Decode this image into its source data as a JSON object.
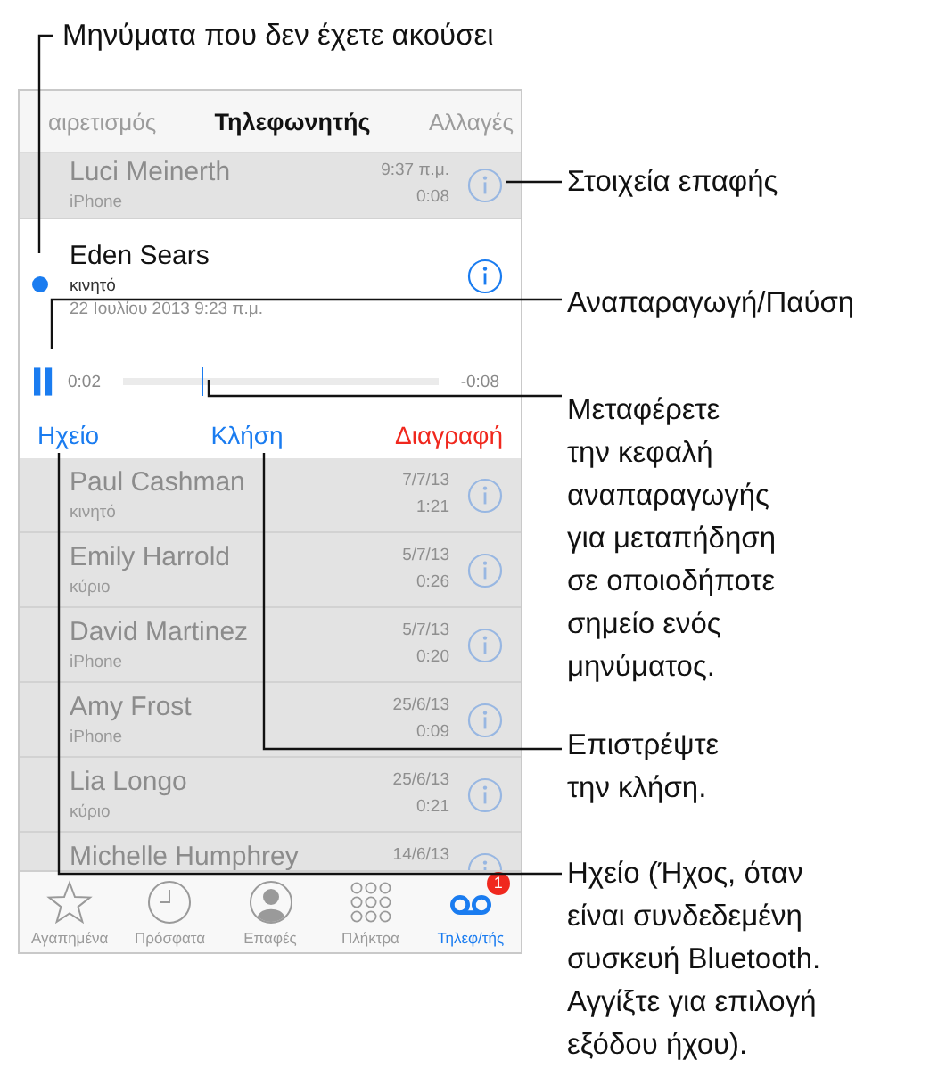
{
  "callouts": [
    {
      "text": "Μηνύματα που δεν έχετε ακούσει"
    },
    {
      "text": "Στοιχεία επαφής"
    },
    {
      "text": "Αναπαραγωγή/Παύση"
    },
    {
      "text": "Μεταφέρετε\nτην κεφαλή\nαναπαραγωγής\nγια μεταπήδηση\nσε οποιοδήποτε\nσημείο ενός\nμηνύματος."
    },
    {
      "text": "Επιστρέψτε\nτην κλήση."
    },
    {
      "text": "Ηχείο (Ήχος, όταν\nείναι συνδεδεμένη\nσυσκευή Bluetooth.\nΑγγίξτε για επιλογή\nεξόδου ήχου)."
    }
  ],
  "phone": {
    "segments": [
      {
        "label": "αιρετισμός",
        "selected": false
      },
      {
        "label": "Τηλεφωνητής",
        "selected": true
      },
      {
        "label": "Αλλαγές",
        "selected": false
      }
    ],
    "messages": [
      {
        "name": "Luci Meinerth",
        "label": "iPhone",
        "time": "9:37 π.μ.",
        "duration": "0:08",
        "selected": false,
        "unheard": false
      },
      {
        "name": "Eden Sears",
        "label": "κινητό",
        "date": "22 Ιουλίου 2013 9:23 π.μ.",
        "selected": true,
        "unheard": true,
        "player": {
          "playing": true,
          "elapsed": "0:02",
          "remaining": "-0:08",
          "level": 0.25
        }
      },
      {
        "name": "Paul Cashman",
        "label": "κινητό",
        "time": "7/7/13",
        "duration": "1:21",
        "selected": false,
        "unheard": false
      },
      {
        "name": "Emily Harrold",
        "label": "κύριο",
        "time": "5/7/13",
        "duration": "0:26",
        "selected": false,
        "unheard": false
      },
      {
        "name": "David Martinez",
        "label": "iPhone",
        "time": "5/7/13",
        "duration": "0:20",
        "selected": false,
        "unheard": false
      },
      {
        "name": "Amy Frost",
        "label": "iPhone",
        "time": "25/6/13",
        "duration": "0:09",
        "selected": false,
        "unheard": false
      },
      {
        "name": "Lia Longo",
        "label": "κύριο",
        "time": "25/6/13",
        "duration": "0:21",
        "selected": false,
        "unheard": false
      },
      {
        "name": "Michelle Humphrey",
        "time": "14/6/13",
        "selected": false,
        "unheard": false
      }
    ],
    "actions": [
      {
        "label": "Ηχείο",
        "kind": "normal"
      },
      {
        "label": "Κλήση",
        "kind": "normal"
      },
      {
        "label": "Διαγραφή",
        "kind": "destructive"
      }
    ],
    "tabs": [
      {
        "label": "Αγαπημένα",
        "kind": "favorites",
        "selected": false
      },
      {
        "label": "Πρόσφατα",
        "kind": "recents",
        "selected": false
      },
      {
        "label": "Επαφές",
        "kind": "contacts",
        "selected": false
      },
      {
        "label": "Πλήκτρα",
        "kind": "keypad",
        "selected": false
      },
      {
        "label": "Τηλεφ/τής",
        "kind": "voicemail",
        "selected": true,
        "badge": "1"
      }
    ]
  }
}
